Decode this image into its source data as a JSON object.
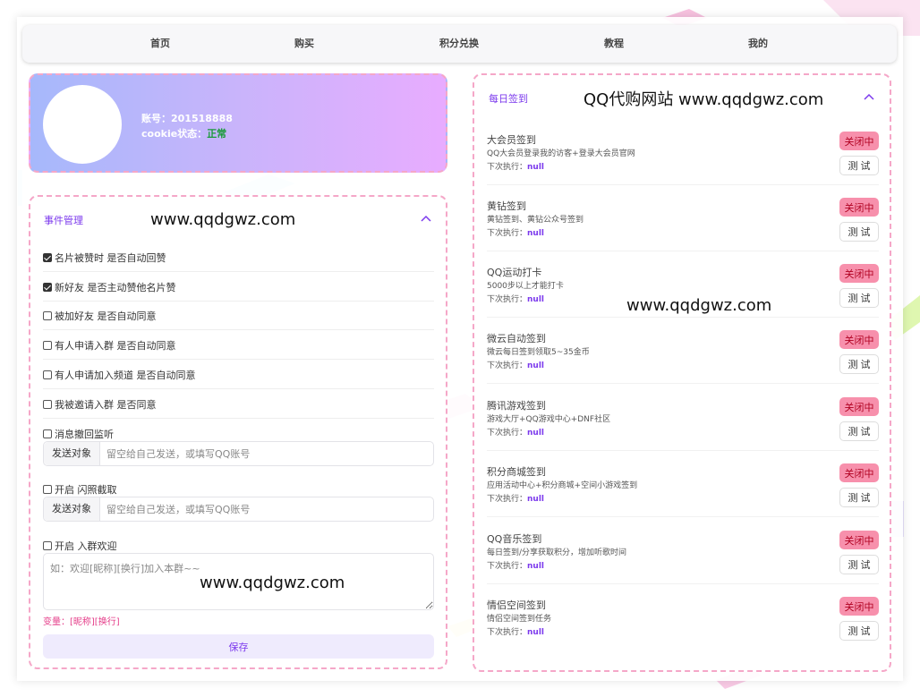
{
  "nav": {
    "items": [
      "首页",
      "购买",
      "积分兑换",
      "教程",
      "我的"
    ]
  },
  "profile": {
    "account_label": "账号：",
    "account_value": "201518888",
    "cookie_label": "cookie状态：",
    "cookie_value": "正常"
  },
  "events": {
    "title": "事件管理",
    "watermark": "www.qqdgwz.com",
    "options": [
      {
        "label": "名片被赞时 是否自动回赞",
        "checked": true
      },
      {
        "label": "新好友 是否主动赞他名片赞",
        "checked": true
      },
      {
        "label": "被加好友 是否自动同意",
        "checked": false
      },
      {
        "label": "有人申请入群 是否自动同意",
        "checked": false
      },
      {
        "label": "有人申请加入频道 是否自动同意",
        "checked": false
      },
      {
        "label": "我被邀请入群 是否同意",
        "checked": false
      },
      {
        "label": "消息撤回监听",
        "checked": false
      },
      {
        "label": "开启 闪照截取",
        "checked": false
      },
      {
        "label": "开启 入群欢迎",
        "checked": false
      }
    ],
    "recall_target": {
      "label": "发送对象",
      "placeholder": "留空给自己发送，或填写QQ账号"
    },
    "flash_target": {
      "label": "发送对象",
      "placeholder": "留空给自己发送，或填写QQ账号"
    },
    "welcome_placeholder": "如：欢迎[昵称][换行]加入本群~~",
    "welcome_watermark": "www.qqdgwz.com",
    "vars": "变量：[昵称][换行]",
    "save_label": "保存"
  },
  "daily": {
    "title": "每日签到",
    "watermark_top": "QQ代购网站 www.qqdgwz.com",
    "watermark_mid": "www.qqdgwz.com",
    "next_label": "下次执行：",
    "off_label": "关闭中",
    "test_label": "测试",
    "tasks": [
      {
        "name": "大会员签到",
        "desc": "QQ大会员登录我的访客+登录大会员官网",
        "next": "null"
      },
      {
        "name": "黄钻签到",
        "desc": "黄钻签到、黄钻公众号签到",
        "next": "null"
      },
      {
        "name": "QQ运动打卡",
        "desc": "5000步以上才能打卡",
        "next": "null"
      },
      {
        "name": "微云自动签到",
        "desc": "微云每日签到领取5~35金币",
        "next": "null"
      },
      {
        "name": "腾讯游戏签到",
        "desc": "游戏大厅+QQ游戏中心+DNF社区",
        "next": "null"
      },
      {
        "name": "积分商城签到",
        "desc": "应用活动中心+积分商城+空间小游戏签到",
        "next": "null"
      },
      {
        "name": "QQ音乐签到",
        "desc": "每日签到/分享获取积分，增加听歌时间",
        "next": "null"
      },
      {
        "name": "情侣空间签到",
        "desc": "情侣空间签到任务",
        "next": "null"
      }
    ]
  },
  "colors": {
    "accent": "#7c3aed",
    "dashed_border": "#f5a7c8",
    "off_button": "#f790ac",
    "status_ok": "#1a9a3a"
  }
}
